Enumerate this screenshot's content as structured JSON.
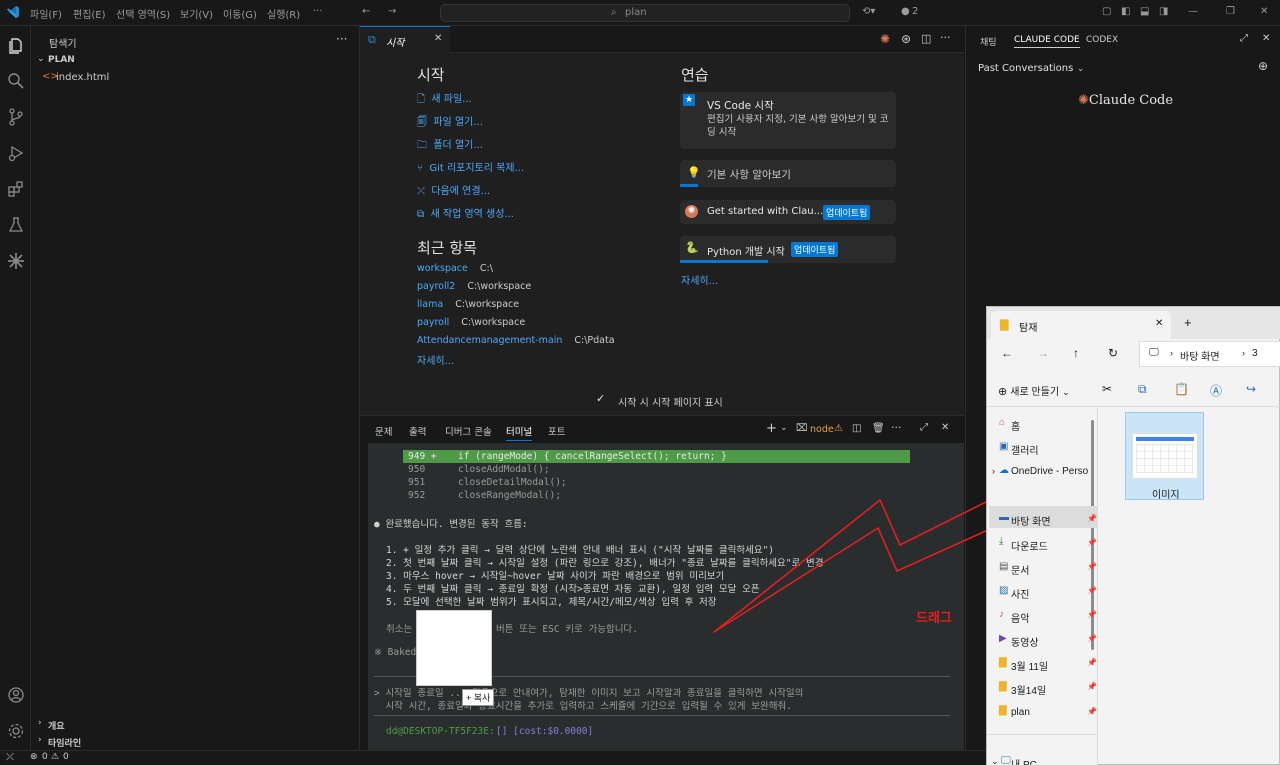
{
  "titlebar": {
    "menus": [
      "파일(F)",
      "편집(E)",
      "선택 영역(S)",
      "보기(V)",
      "이동(G)",
      "실행(R)"
    ],
    "search_placeholder": "plan",
    "notif_count": "2"
  },
  "sidebar": {
    "title": "탐색기",
    "folder": "PLAN",
    "file": "index.html",
    "section_outline": "개요",
    "section_timeline": "타임라인"
  },
  "editor": {
    "tab_label": "시작",
    "start": {
      "heading": "시작",
      "actions": [
        "새 파일...",
        "파일 열기...",
        "폴더 열기...",
        "Git 리포지토리 복제...",
        "다음에 연결...",
        "새 작업 영역 생성..."
      ]
    },
    "recent": {
      "heading": "최근 항목",
      "items": [
        {
          "name": "workspace",
          "path": "C:\\"
        },
        {
          "name": "payroll2",
          "path": "C:\\workspace"
        },
        {
          "name": "llama",
          "path": "C:\\workspace"
        },
        {
          "name": "payroll",
          "path": "C:\\workspace"
        },
        {
          "name": "Attendancemanagement-main",
          "path": "C:\\Pdata"
        }
      ],
      "more": "자세히..."
    },
    "learn": {
      "heading": "연습",
      "featured_title": "VS Code 시작",
      "featured_desc": "편집기 사용자 지정, 기본 사항 알아보기 및 코딩 시작",
      "basics": "기본 사항 알아보기",
      "claude_item": "Get started with Clau...",
      "python_item": "Python 개발 시작",
      "badge": "업데이트됨",
      "more": "자세히..."
    },
    "show_on_startup": "시작 시 시작 페이지 표시"
  },
  "panel": {
    "tabs": [
      "문제",
      "출력",
      "디버그 콘솔",
      "터미널",
      "포트"
    ],
    "active_tab": "터미널",
    "terminal_name": "node",
    "code_lines": [
      {
        "num": "949 +",
        "text": "if (rangeMode) { cancelRangeSelect(); return; }"
      },
      {
        "num": "950",
        "text": "closeAddModal();"
      },
      {
        "num": "951",
        "text": "closeDetailModal();"
      },
      {
        "num": "952",
        "text": "closeRangeModal();"
      }
    ],
    "done_line": "● 완료했습니다. 변경된 동작 흐름:",
    "steps": [
      "1. + 일정 추가 클릭 → 달력 상단에 노란색 안내 배너 표시 (\"시작 날짜를 클릭하세요\")",
      "2. 첫 번째 날짜 클릭 → 시작일 설정 (파란 링으로 강조), 배너가 \"종료 날짜를 클릭하세요\"로 변경",
      "3. 마우스 hover → 시작일~hover 날짜 사이가 파란 배경으로 범위 미리보기",
      "4. 두 번째 날짜 클릭 → 종료일 확정 (시작>종료면 자동 교환), 일정 입력 모달 오픈",
      "5. 모달에 선택한 날짜 범위가 표시되고, 제목/시간/메모/색상 입력 후 저장"
    ],
    "cancel_pre": "취소는",
    "cancel_post": "버튼 또는 ESC 키로 가능합니다.",
    "baked": "※ Baked",
    "prompt_line1": "> 시작일 종료일 ... 다음으로 안내여가, 탐재한 이미지 보고 시작알과 종료일을 클릭하면 시작일의",
    "prompt_line2": "  시작 시간, 종료일과 종료시간을 추가로 입력하고 스케쥴에 기간으로 입력될 수 있게 보완해줘.",
    "copy_label": "+ 복사",
    "shell_prompt": "dd@DESKTOP-TF5F23E:",
    "shell_extra": "[] [cost:$0.0000]"
  },
  "annotation": {
    "drag_label": "드래그",
    "arrow_color": "#e02020"
  },
  "right_panel": {
    "tabs": [
      "채팅",
      "CLAUDE CODE",
      "CODEX"
    ],
    "active_tab": "CLAUDE CODE",
    "past_conversations": "Past Conversations",
    "brand": "Claude Code",
    "brand_color": "#d97757"
  },
  "statusbar": {
    "errors": "0",
    "warnings": "0"
  },
  "file_explorer": {
    "tab_title": "탐재",
    "breadcrumb": [
      "바탕 화면",
      "3"
    ],
    "new_button": "새로 만들기",
    "nav": [
      {
        "label": "홈",
        "pinned": false
      },
      {
        "label": "갤러리",
        "pinned": false
      },
      {
        "label": "OneDrive - Perso",
        "pinned": false
      },
      {
        "label": "바탕 화면",
        "pinned": true
      },
      {
        "label": "다운로드",
        "pinned": true
      },
      {
        "label": "문서",
        "pinned": true
      },
      {
        "label": "사진",
        "pinned": true
      },
      {
        "label": "음악",
        "pinned": true
      },
      {
        "label": "동영상",
        "pinned": true
      },
      {
        "label": "3월 11일",
        "pinned": true
      },
      {
        "label": "3월14일",
        "pinned": true
      },
      {
        "label": "plan",
        "pinned": true
      }
    ],
    "this_pc": "내 PC",
    "file_label": "이미지"
  }
}
